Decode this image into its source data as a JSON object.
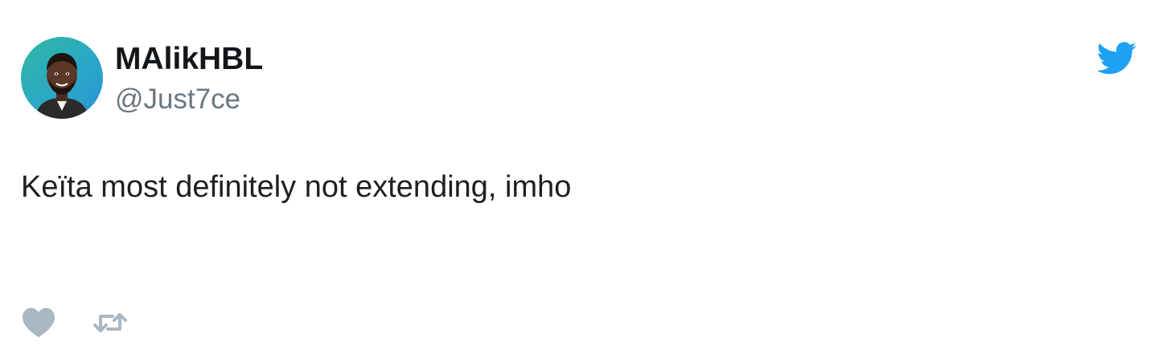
{
  "tweet": {
    "author_name": "MAlikHBL",
    "author_handle": "@Just7ce",
    "text": "Keïta most definitely not extending, imho"
  },
  "icons": {
    "brand": "twitter-bird-icon",
    "like": "heart-icon",
    "retweet": "retweet-icon",
    "avatar": "avatar-image"
  },
  "colors": {
    "brand_blue": "#1da1f2",
    "action_gray": "#aab8c2",
    "name": "#14171a",
    "handle": "#697882",
    "text": "#1c2022"
  }
}
